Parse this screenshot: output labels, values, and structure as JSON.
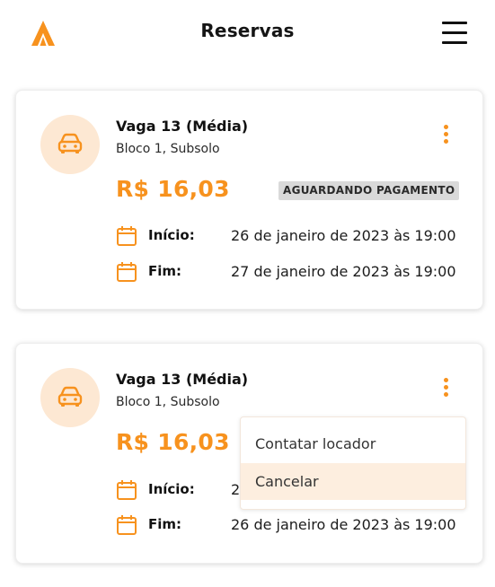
{
  "header": {
    "title": "Reservas",
    "logo_icon": "brand-a-logo",
    "menu_icon": "hamburger-menu-icon"
  },
  "colors": {
    "accent": "#f7921e",
    "avatar_bg": "#fde8d3",
    "badge_bg": "#d9d9d9",
    "highlight": "#fdeedf"
  },
  "reservations": [
    {
      "title": "Vaga 13 (Média)",
      "location": "Bloco 1, Subsolo",
      "price": "R$ 16,03",
      "status": "AGUARDANDO PAGAMENTO",
      "start_label": "Início:",
      "start_value": "26 de janeiro de 2023 às 19:00",
      "end_label": "Fim:",
      "end_value": "27 de janeiro de 2023 às 19:00"
    },
    {
      "title": "Vaga 13 (Média)",
      "location": "Bloco 1, Subsolo",
      "price": "R$ 16,03",
      "start_label": "Início:",
      "start_value_visible": "2",
      "end_label": "Fim:",
      "end_value": "26 de janeiro de 2023 às 19:00"
    }
  ],
  "dropdown": {
    "items": [
      "Contatar locador",
      "Cancelar"
    ],
    "highlighted": "Cancelar"
  }
}
